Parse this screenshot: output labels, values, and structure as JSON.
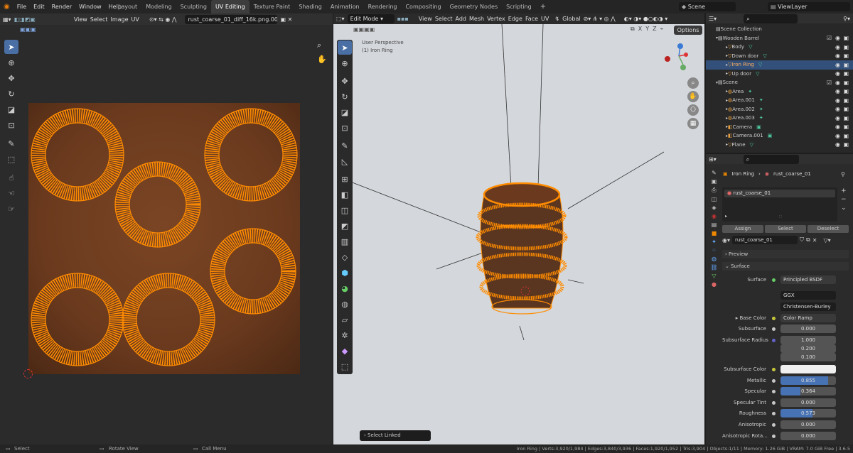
{
  "menu": [
    "File",
    "Edit",
    "Render",
    "Window",
    "Help"
  ],
  "workspaces": [
    "Layout",
    "Modeling",
    "Sculpting",
    "UV Editing",
    "Texture Paint",
    "Shading",
    "Animation",
    "Rendering",
    "Compositing",
    "Geometry Nodes",
    "Scripting"
  ],
  "active_workspace": "UV Editing",
  "scene_label": "Scene",
  "view_layer_label": "ViewLayer",
  "uv_editor": {
    "menus": [
      "View",
      "Select",
      "Image",
      "UV"
    ],
    "image_name": "rust_coarse_01_diff_16k.png.001"
  },
  "viewport": {
    "mode": "Edit Mode",
    "menus": [
      "View",
      "Select",
      "Add",
      "Mesh",
      "Vertex",
      "Edge",
      "Face",
      "UV"
    ],
    "orientation": "Global",
    "axes": [
      "X",
      "Y",
      "Z"
    ],
    "options_label": "Options",
    "overlay_line1": "User Perspective",
    "overlay_line2": "(1) Iron Ring",
    "select_linked_label": "Select Linked"
  },
  "outliner": {
    "title": "Scene Collection",
    "items": [
      {
        "label": "Wooden Barrel",
        "kind": "collection",
        "indent": 0
      },
      {
        "label": "Body",
        "kind": "mesh",
        "indent": 1
      },
      {
        "label": "Down door",
        "kind": "mesh",
        "indent": 1
      },
      {
        "label": "Iron Ring",
        "kind": "mesh",
        "indent": 1,
        "selected": true
      },
      {
        "label": "Up door",
        "kind": "mesh",
        "indent": 1
      },
      {
        "label": "Scene",
        "kind": "collection",
        "indent": 0
      },
      {
        "label": "Area",
        "kind": "light",
        "indent": 1
      },
      {
        "label": "Area.001",
        "kind": "light",
        "indent": 1
      },
      {
        "label": "Area.002",
        "kind": "light",
        "indent": 1
      },
      {
        "label": "Area.003",
        "kind": "light",
        "indent": 1
      },
      {
        "label": "Camera",
        "kind": "camera",
        "indent": 1
      },
      {
        "label": "Camera.001",
        "kind": "camera",
        "indent": 1
      },
      {
        "label": "Plane",
        "kind": "mesh",
        "indent": 1
      }
    ]
  },
  "properties": {
    "breadcrumb_object": "Iron Ring",
    "breadcrumb_material": "rust_coarse_01",
    "slot_name": "rust_coarse_01",
    "assign_label": "Assign",
    "select_label": "Select",
    "deselect_label": "Deselect",
    "material_name": "rust_coarse_01",
    "preview_label": "Preview",
    "surface_section": "Surface",
    "surface_label": "Surface",
    "surface_value": "Principled BSDF",
    "distribution": "GGX",
    "subsurface_method": "Christensen-Burley",
    "base_color_label": "Base Color",
    "base_color_value": "Color Ramp",
    "subsurface_label": "Subsurface",
    "subsurface_value": "0.000",
    "subsurface_radius_label": "Subsurface Radius",
    "subsurface_radius": [
      "1.000",
      "0.200",
      "0.100"
    ],
    "subsurface_color_label": "Subsurface Color",
    "metallic_label": "Metallic",
    "metallic_value": "0.855",
    "metallic_fraction": 0.855,
    "specular_label": "Specular",
    "specular_value": "0.364",
    "specular_fraction": 0.364,
    "specular_tint_label": "Specular Tint",
    "specular_tint_value": "0.000",
    "roughness_label": "Roughness",
    "roughness_value": "0.573",
    "roughness_fraction": 0.573,
    "anisotropic_label": "Anisotropic",
    "anisotropic_value": "0.000",
    "anisotropic_rotation_label": "Anisotropic Rota...",
    "anisotropic_rotation_value": "0.000"
  },
  "status": {
    "select": "Select",
    "rotate_view": "Rotate View",
    "call_menu": "Call Menu",
    "stats": "Iron Ring | Verts:3,920/1,984 | Edges:3,840/3,936 | Faces:1,920/1,952 | Tris:3,904 | Objects:1/11 | Memory: 1.26 GiB | VRAM: 7.0 GiB Free | 3.6.5"
  },
  "colors": {
    "accent": "#4772b3",
    "selected_row": "#33507a",
    "uv_orange": "#ff8c00",
    "rust_texture": "#6b3a1e",
    "viewport_bg": "#d4d7dc"
  }
}
